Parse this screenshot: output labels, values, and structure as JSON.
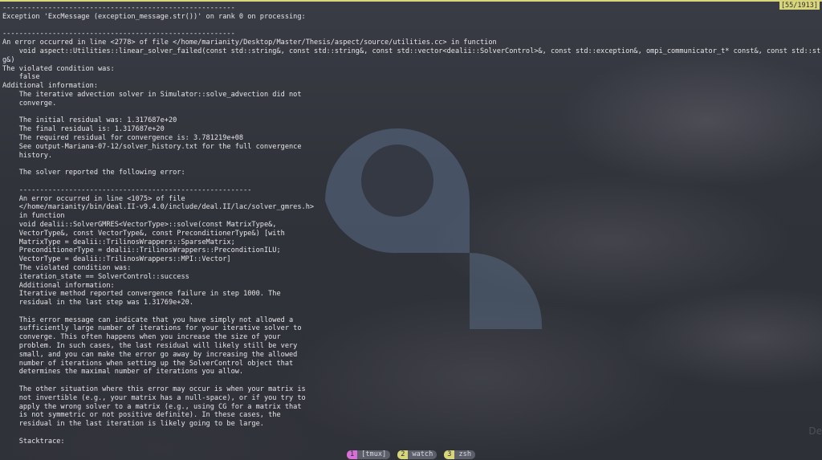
{
  "colors": {
    "background": "#33353d",
    "text": "#e6e6e8",
    "accent_yellow": "#d8d57a",
    "cursor": "#62c6ee",
    "tab_magenta": "#d86fd8",
    "tab_yellow": "#d8d57a",
    "tab_name_bg": "#5c5e6a",
    "logo_tint": "#5a6d86"
  },
  "header": {
    "page_indicator": "[55/1913]"
  },
  "terminal": {
    "lines": [
      "--------------------------------------------------------",
      "Exception 'ExcMessage (exception_message.str())' on rank 0 on processing:",
      "",
      "--------------------------------------------------------",
      "An error occurred in line <2778> of file </home/marianity/Desktop/Master/Thesis/aspect/source/utilities.cc> in function",
      "    void aspect::Utilities::linear_solver_failed(const std::string&, const std::string&, const std::vector<dealii::SolverControl>&, const std::exception&, ompi_communicator_t* const&, const std::strin",
      "g&)",
      "The violated condition was:",
      "    false",
      "Additional information:",
      "    The iterative advection solver in Simulator::solve_advection did not",
      "    converge.",
      "",
      "    The initial residual was: 1.317687e+20",
      "    The final residual is: 1.317687e+20",
      "    The required residual for convergence is: 3.781219e+08",
      "    See output-Mariana-07-12/solver_history.txt for the full convergence",
      "    history.",
      "",
      "    The solver reported the following error:",
      "",
      "    --------------------------------------------------------",
      "    An error occurred in line <1075> of file",
      "    </home/marianity/bin/deal.II-v9.4.0/include/deal.II/lac/solver_gmres.h>",
      "    in function",
      "    void dealii::SolverGMRES<VectorType>::solve(const MatrixType&,",
      "    VectorType&, const VectorType&, const PreconditionerType&) [with",
      "    MatrixType = dealii::TrilinosWrappers::SparseMatrix;",
      "    PreconditionerType = dealii::TrilinosWrappers::PreconditionILU;",
      "    VectorType = dealii::TrilinosWrappers::MPI::Vector]",
      "    The violated condition was:",
      "    iteration_state == SolverControl::success",
      "    Additional information:",
      "    Iterative method reported convergence failure in step 1000. The",
      "    residual in the last step was 1.31769e+20.",
      "",
      "    This error message can indicate that you have simply not allowed a",
      "    sufficiently large number of iterations for your iterative solver to",
      "    converge. This often happens when you increase the size of your",
      "    problem. In such cases, the last residual will likely still be very",
      "    small, and you can make the error go away by increasing the allowed",
      "    number of iterations when setting up the SolverControl object that",
      "    determines the maximal number of iterations you allow.",
      "",
      "    The other situation where this error may occur is when your matrix is",
      "    not invertible (e.g., your matrix has a null-space), or if you try to",
      "    apply the wrong solver to a matrix (e.g., using CG for a matrix that",
      "    is not symmetric or not positive definite). In these cases, the",
      "    residual in the last iteration is likely going to be large.",
      "",
      "    Stacktrace:"
    ],
    "last_line": "    ----------"
  },
  "status_bar": {
    "windows": [
      {
        "index": "1",
        "name": "[tmux]",
        "icon": "window-tab-icon"
      },
      {
        "index": "2",
        "name": "watch",
        "icon": "window-tab-icon"
      },
      {
        "index": "3",
        "name": "zsh",
        "icon": "window-tab-icon"
      }
    ]
  },
  "decor": {
    "corner_text": "De"
  }
}
